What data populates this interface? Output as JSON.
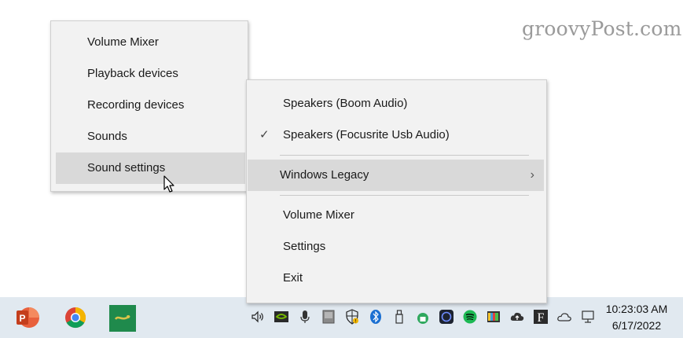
{
  "watermark": "groovyPost.com",
  "left_menu": {
    "items": [
      {
        "label": "Volume Mixer"
      },
      {
        "label": "Playback devices"
      },
      {
        "label": "Recording devices"
      },
      {
        "label": "Sounds"
      },
      {
        "label": "Sound settings",
        "highlighted": true
      }
    ]
  },
  "right_menu": {
    "devices": [
      {
        "label": "Speakers (Boom Audio)",
        "checked": false
      },
      {
        "label": "Speakers (Focusrite Usb Audio)",
        "checked": true
      }
    ],
    "submenu": {
      "label": "Windows Legacy",
      "highlighted": true
    },
    "items": [
      {
        "label": "Volume Mixer"
      },
      {
        "label": "Settings"
      },
      {
        "label": "Exit"
      }
    ]
  },
  "icons": {
    "check": "✓",
    "chevron": "›"
  },
  "taskbar": {
    "apps": [
      "powerpoint-icon",
      "chrome-icon",
      "app-icon"
    ],
    "tray": [
      "speaker-icon",
      "nvidia-icon",
      "microphone-icon",
      "drive-icon",
      "security-icon",
      "bluetooth-icon",
      "usb-icon",
      "lock-icon",
      "app-icon",
      "spotify-icon",
      "colorbars-icon",
      "cloud-upload-icon",
      "f-icon",
      "onedrive-icon",
      "network-icon"
    ],
    "time": "10:23:03 AM",
    "date": "6/17/2022"
  },
  "colors": {
    "menu_bg": "#f2f2f2",
    "highlight": "#d9d9d9",
    "taskbar_bg": "#e1e9f0",
    "powerpoint": "#c43e1c",
    "app_green": "#1f8a4c",
    "spotify": "#1db954",
    "bluetooth": "#1a6fd1"
  }
}
